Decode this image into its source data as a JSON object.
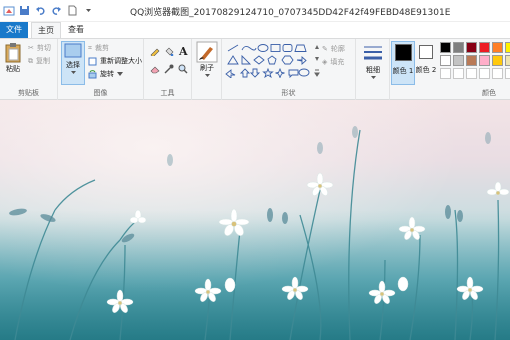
{
  "window": {
    "title": "QQ浏览器截图_20170829124710_0707345DD42F42f49FEBD48E91301E89 - 画图"
  },
  "tabs": {
    "file": "文件",
    "home": "主页",
    "view": "查看"
  },
  "clipboard": {
    "paste": "粘贴",
    "cut": "剪切",
    "copy": "复制",
    "label": "剪贴板"
  },
  "image": {
    "select": "选择",
    "crop": "裁剪",
    "resize": "重新调整大小",
    "rotate": "旋转",
    "label": "图像"
  },
  "tools": {
    "label": "工具"
  },
  "brushes": {
    "label": "刷子"
  },
  "shapes": {
    "outline": "轮廓",
    "fill": "填充",
    "label": "形状"
  },
  "size": {
    "label": "粗细"
  },
  "colors": {
    "color1": "颜色 1",
    "color2": "颜色 2",
    "label": "颜色",
    "palette_row1": [
      "#000000",
      "#7f7f7f",
      "#880015",
      "#ed1c24",
      "#ff7f27",
      "#fff200"
    ],
    "palette_row2": [
      "#ffffff",
      "#c3c3c3",
      "#b97a57",
      "#ffaec9",
      "#ffc90e",
      "#efe4b0"
    ],
    "palette_row3": [
      "#ffffff",
      "#ffffff",
      "#ffffff",
      "#ffffff",
      "#ffffff",
      "#ffffff"
    ],
    "color1_value": "#000000",
    "color2_value": "#ffffff"
  }
}
